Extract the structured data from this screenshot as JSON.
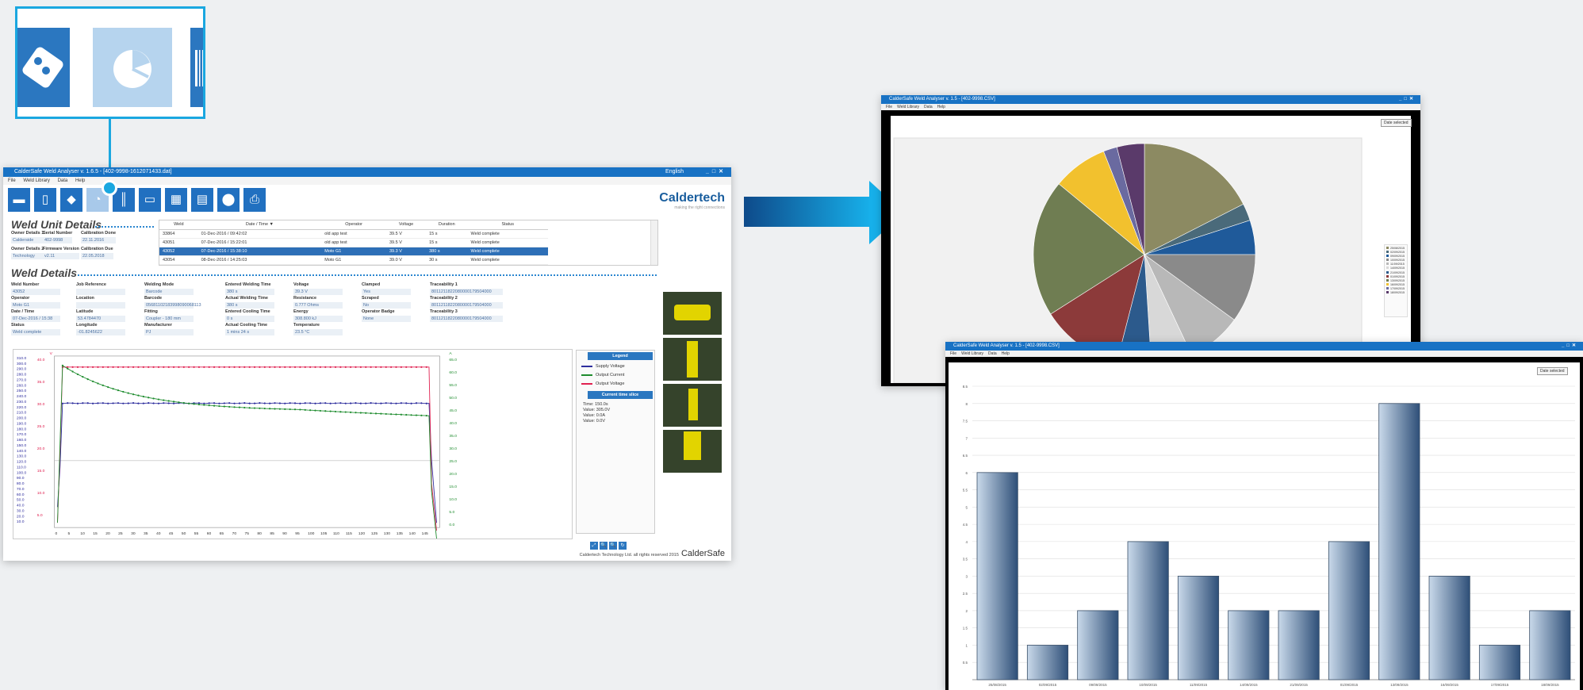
{
  "main_window": {
    "title": "CalderSafe Weld Analyser  v. 1.6.5 - [402-9998-1612071433.dat]",
    "language": "English",
    "menu": [
      "File",
      "Weld Library",
      "Data",
      "Help"
    ],
    "toolbar_icons": [
      "folder-icon",
      "phone-icon",
      "tag-icon",
      "pie-chart-icon",
      "barcode-icon",
      "book-icon",
      "table-icon",
      "report-icon",
      "location-pin-icon",
      "printer-icon"
    ],
    "brand": "Caldertech",
    "brand_tagline": "making the right connections",
    "weld_unit_details": {
      "title": "Weld Unit Details",
      "fields": [
        {
          "label": "Owner Details 1",
          "value": "Calderside"
        },
        {
          "label": "Serial Number",
          "value": "402-9998"
        },
        {
          "label": "Calibration Done",
          "value": "22.11.2016"
        },
        {
          "label": "Owner Details 2",
          "value": "Technology"
        },
        {
          "label": "Firmware Version",
          "value": "v2.11"
        },
        {
          "label": "Calibration Due",
          "value": "22.05.2018"
        }
      ]
    },
    "records": {
      "columns": [
        "Weld",
        "Date / Time ▼",
        "Operator",
        "Voltage",
        "Duration",
        "Status"
      ],
      "rows": [
        [
          "33864",
          "01-Dec-2016 / 09:42:02",
          "old app test",
          "39.5 V",
          "15 s",
          "Weld complete"
        ],
        [
          "43051",
          "07-Dec-2016 / 15:22:01",
          "old app test",
          "39.5 V",
          "15 s",
          "Weld complete"
        ],
        [
          "43052",
          "07-Dec-2016 / 15:38:10",
          "Moto G1",
          "39.3 V",
          "380 s",
          "Weld complete"
        ],
        [
          "43054",
          "08-Dec-2016 / 14:25:03",
          "Moto G1",
          "39.0 V",
          "30 s",
          "Weld complete"
        ]
      ],
      "selected_index": 2
    },
    "weld_details": {
      "title": "Weld Details",
      "fields": [
        {
          "label": "Weld Number",
          "value": "43052"
        },
        {
          "label": "Job Reference",
          "value": ""
        },
        {
          "label": "Welding Mode",
          "value": "Barcode"
        },
        {
          "label": "Entered Welding Time",
          "value": "380 s"
        },
        {
          "label": "Voltage",
          "value": "39.3 V"
        },
        {
          "label": "Clamped",
          "value": "Yes"
        },
        {
          "label": "Traceability 1",
          "value": "8011211822080000179504000"
        },
        {
          "label": "Operator",
          "value": "Moto G1"
        },
        {
          "label": "Location",
          "value": ""
        },
        {
          "label": "Barcode",
          "value": "05681102183998090068113"
        },
        {
          "label": "Actual Welding Time",
          "value": "380 s"
        },
        {
          "label": "Resistance",
          "value": "0.777 Ohms"
        },
        {
          "label": "Scraped",
          "value": "No"
        },
        {
          "label": "Traceability 2",
          "value": "8011211822080000179504000"
        },
        {
          "label": "Date / Time",
          "value": "07-Dec-2016 / 15:38"
        },
        {
          "label": "Latitude",
          "value": "53.4784470"
        },
        {
          "label": "Fitting",
          "value": "Coupler - 180 mm"
        },
        {
          "label": "Entered Cooling Time",
          "value": "0 s"
        },
        {
          "label": "Energy",
          "value": "308.800 kJ"
        },
        {
          "label": "Operator Badge",
          "value": "None"
        },
        {
          "label": "Traceability 3",
          "value": "8011211822080000179504000"
        },
        {
          "label": "Status",
          "value": "Weld complete"
        },
        {
          "label": "Longitude",
          "value": "-01.8245622"
        },
        {
          "label": "Manufacturer",
          "value": "PJ"
        },
        {
          "label": "Actual Cooling Time",
          "value": "1 mins 24 s"
        },
        {
          "label": "Temperature",
          "value": "23.5 °C"
        }
      ]
    },
    "graph": {
      "left_axis_outer": [
        "310.0",
        "300.0",
        "290.0",
        "280.0",
        "270.0",
        "260.0",
        "250.0",
        "240.0",
        "230.0",
        "220.0",
        "210.0",
        "200.0",
        "190.0",
        "180.0",
        "170.0",
        "160.0",
        "150.0",
        "140.0",
        "130.0",
        "120.0",
        "110.0",
        "100.0",
        "90.0",
        "80.0",
        "70.0",
        "60.0",
        "50.0",
        "40.0",
        "30.0",
        "20.0",
        "10.0"
      ],
      "left_axis_inner": [
        "40.0",
        "35.0",
        "30.0",
        "25.0",
        "20.0",
        "15.0",
        "10.0",
        "5.0"
      ],
      "right_axis": [
        "65.0",
        "60.0",
        "55.0",
        "50.0",
        "45.0",
        "40.0",
        "35.0",
        "30.0",
        "25.0",
        "20.0",
        "15.0",
        "10.0",
        "5.0",
        "0.0"
      ],
      "right_unit": "A",
      "left_unit": "V",
      "x_ticks": [
        "0",
        "5",
        "10",
        "15",
        "20",
        "25",
        "30",
        "35",
        "40",
        "45",
        "50",
        "55",
        "60",
        "65",
        "70",
        "75",
        "80",
        "85",
        "90",
        "95",
        "100",
        "105",
        "110",
        "115",
        "120",
        "125",
        "130",
        "135",
        "140",
        "145"
      ],
      "series": [
        {
          "name": "Supply Voltage",
          "color": "#2e2e9e"
        },
        {
          "name": "Output Current",
          "color": "#1e8c2e"
        },
        {
          "name": "Output Voltage",
          "color": "#e02050"
        }
      ],
      "legend_title": "Legend",
      "time_slice_title": "Current time slice",
      "time_slice": [
        "Time: 150.0s",
        "Value: 305.0V",
        "Value: 0.0A",
        "Value: 0.0V"
      ],
      "controls": [
        "⤢",
        "🔍",
        "🔍",
        "↻"
      ]
    },
    "footer_text": "Caldertech Technology Ltd. all rights reserved 2015",
    "footer_brand": "CalderSafe"
  },
  "pie_window": {
    "title": "CalderSafe Weld Analyser  v. 1.5 - [402-9998.CSV]",
    "language": "English",
    "menu": [
      "File",
      "Weld Library",
      "Data",
      "Help"
    ],
    "date_button": "Date selected",
    "slices": [
      {
        "value": 17.5,
        "color": "#8c8a62"
      },
      {
        "value": 2.5,
        "color": "#4a6a7a"
      },
      {
        "value": 5,
        "color": "#1f5a9a"
      },
      {
        "value": 10,
        "color": "#8a8a8a"
      },
      {
        "value": 8,
        "color": "#b8b8b8"
      },
      {
        "value": 6,
        "color": "#d8d8d8"
      },
      {
        "value": 5,
        "color": "#2c5a8c"
      },
      {
        "value": 12,
        "color": "#8c3a3a"
      },
      {
        "value": 20,
        "color": "#6f7d52"
      },
      {
        "value": 8,
        "color": "#f2c12e"
      },
      {
        "value": 2,
        "color": "#6a6aa0"
      },
      {
        "value": 4,
        "color": "#5a3a6a"
      }
    ],
    "legend": [
      "25/08/2015",
      "02/09/2015",
      "09/09/2015",
      "10/09/2015",
      "11/09/2015",
      "14/09/2015",
      "21/09/2015",
      "01/09/2015",
      "13/09/2015",
      "16/09/2015",
      "17/09/2015",
      "18/09/2015"
    ]
  },
  "bar_window": {
    "title": "CalderSafe Weld Analyser  v. 1.5 - [402-9998.CSV]",
    "language": "English",
    "menu": [
      "File",
      "Weld Library",
      "Data",
      "Help"
    ],
    "date_button": "Date selected",
    "chart_data": {
      "type": "bar",
      "categories": [
        "25/08/2015",
        "02/09/2015",
        "09/09/2015",
        "10/09/2015",
        "11/09/2015",
        "14/09/2015",
        "21/09/2015",
        "01/09/2015",
        "13/09/2015",
        "16/09/2015",
        "17/09/2015",
        "18/09/2015"
      ],
      "values": [
        6,
        1,
        2,
        4,
        3,
        2,
        2,
        4,
        8,
        3,
        1,
        2
      ],
      "y_ticks": [
        "0.5",
        "1",
        "1.5",
        "2",
        "2.5",
        "3",
        "3.5",
        "4",
        "4.5",
        "5",
        "5.5",
        "6",
        "6.5",
        "7",
        "7.5",
        "8",
        "8.5"
      ],
      "ylim": [
        0,
        8.5
      ],
      "grid": true
    }
  }
}
